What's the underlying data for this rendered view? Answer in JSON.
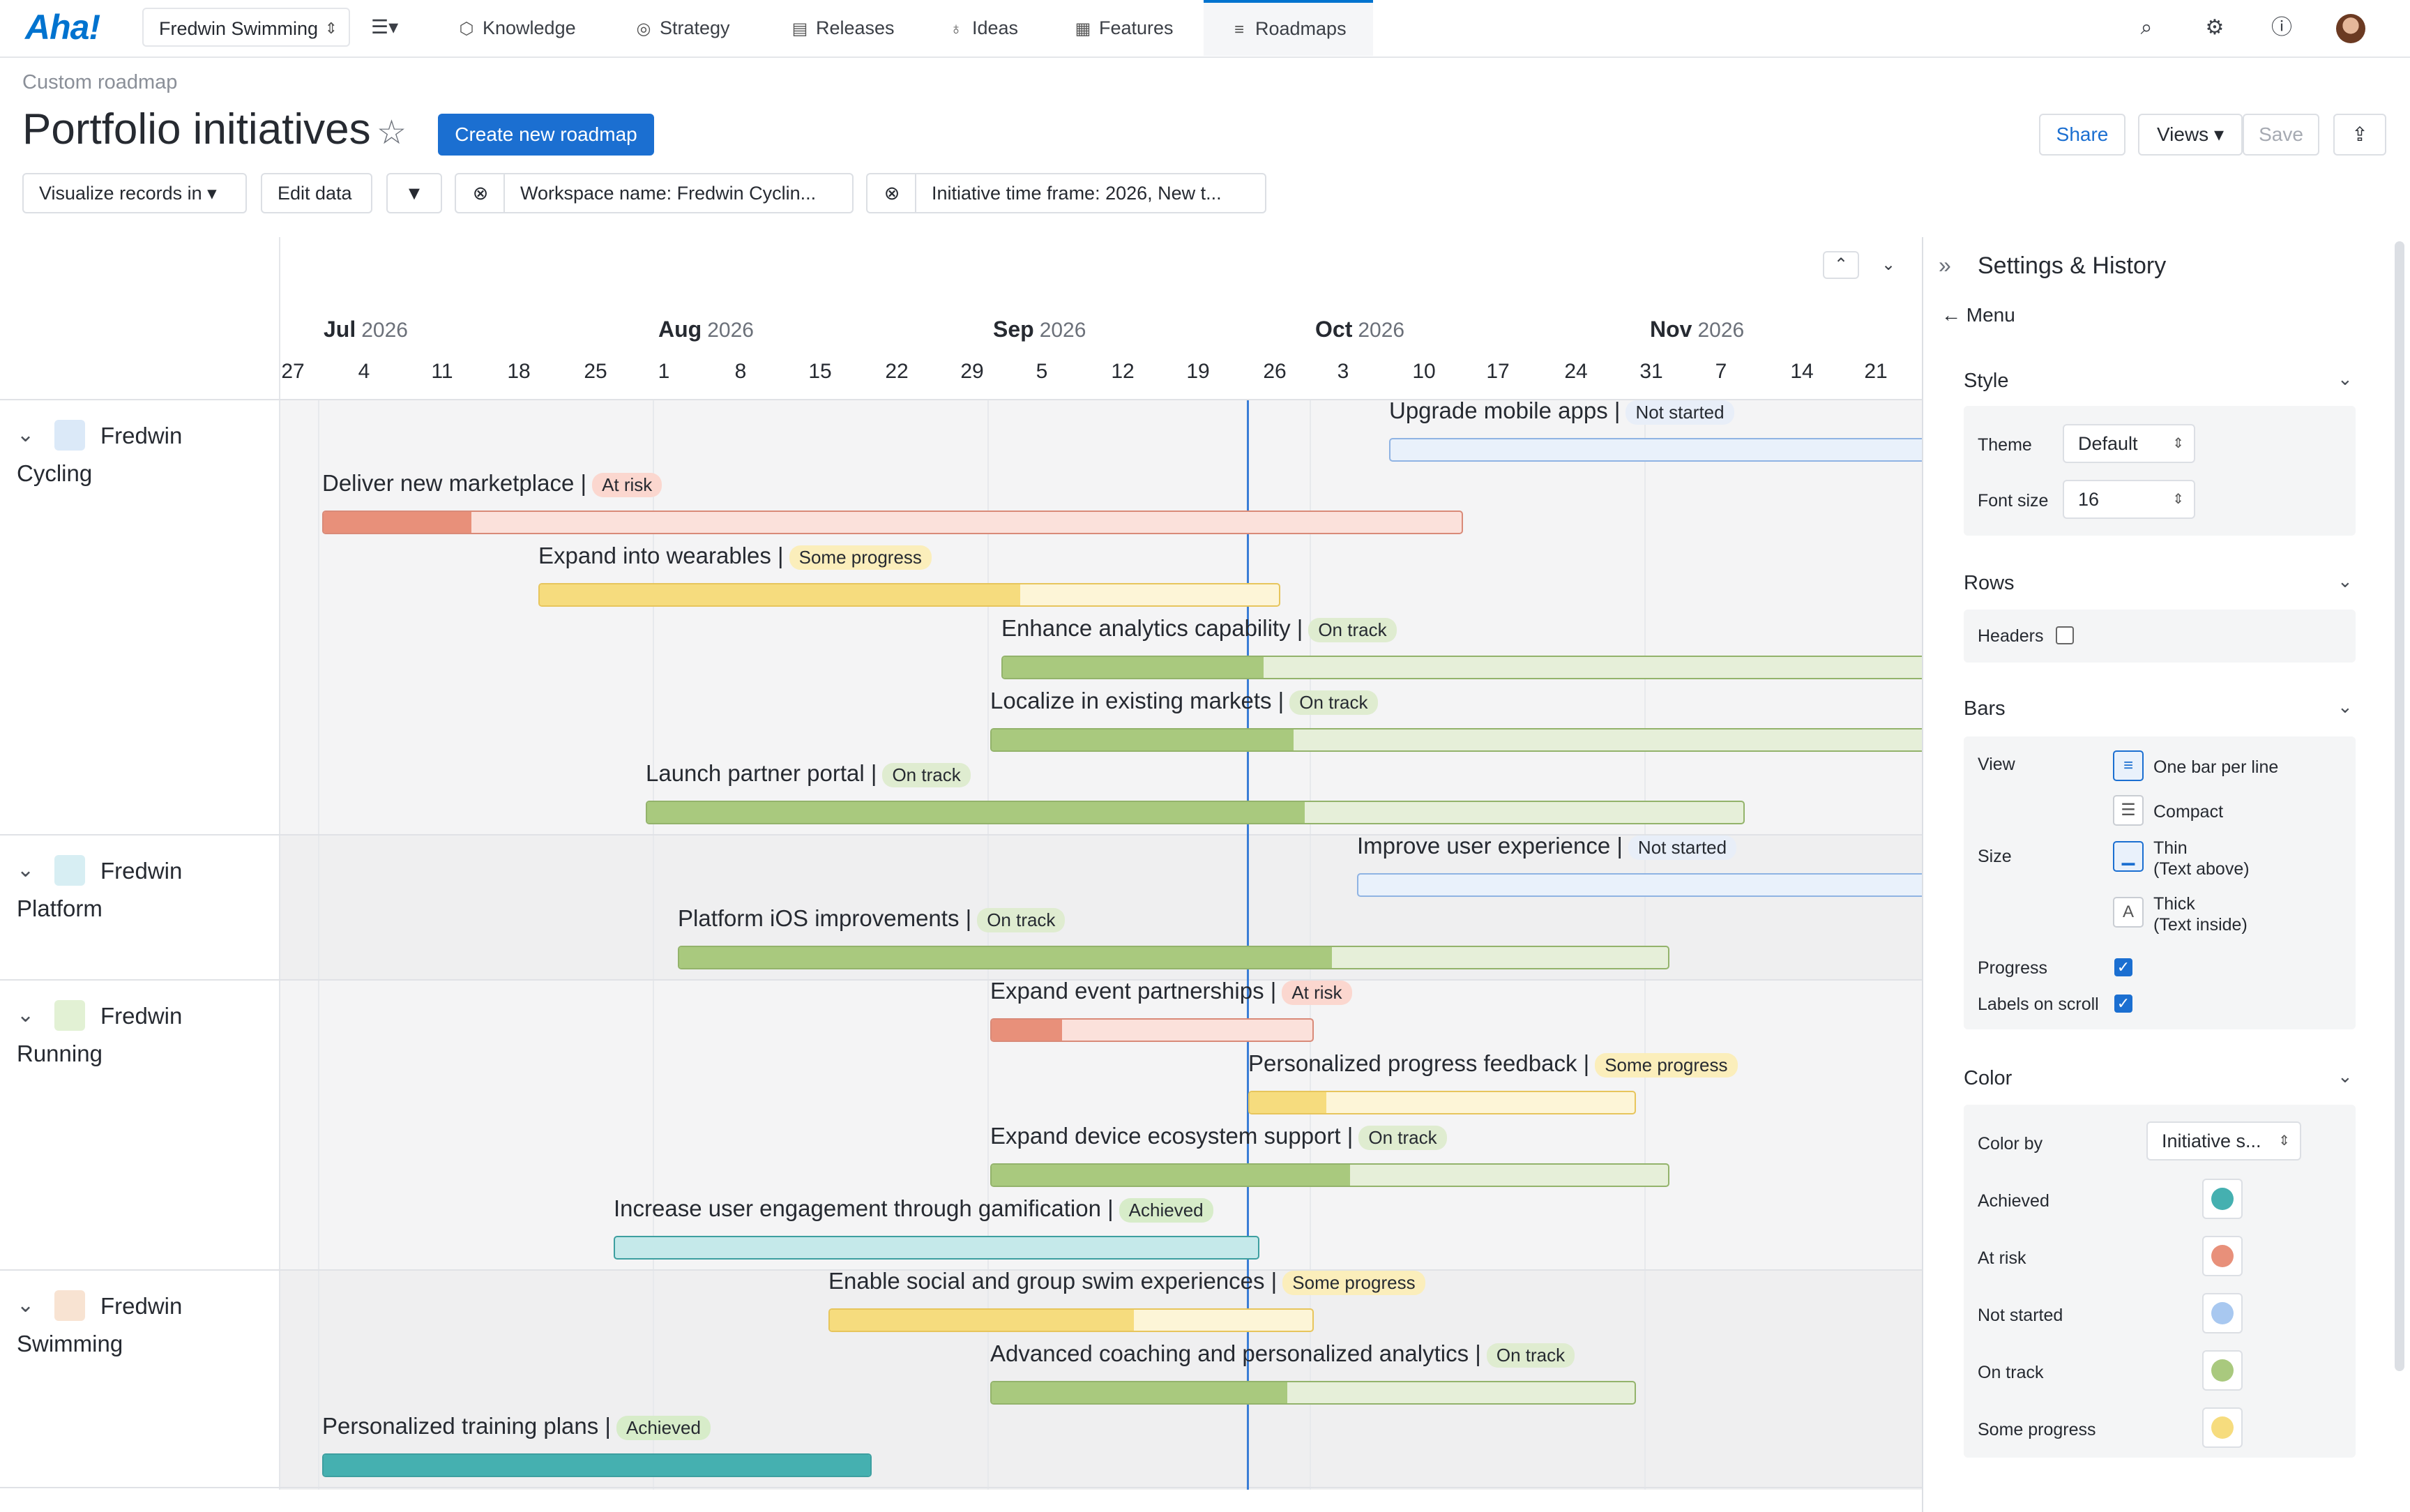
{
  "nav": {
    "logo": "Aha!",
    "workspace": "Fredwin Swimming",
    "items": [
      {
        "label": "Knowledge",
        "icon": "knowledge-icon"
      },
      {
        "label": "Strategy",
        "icon": "strategy-icon"
      },
      {
        "label": "Releases",
        "icon": "releases-icon"
      },
      {
        "label": "Ideas",
        "icon": "ideas-icon"
      },
      {
        "label": "Features",
        "icon": "features-icon"
      },
      {
        "label": "Roadmaps",
        "icon": "roadmaps-icon"
      }
    ]
  },
  "header": {
    "breadcrumb": "Custom roadmap",
    "title": "Portfolio initiatives",
    "create_label": "Create new roadmap",
    "share_label": "Share",
    "views_label": "Views ▾",
    "save_label": "Save"
  },
  "toolbar": {
    "visualize_label": "Visualize records in ▾",
    "edit_label": "Edit data",
    "filter1": "Workspace name: Fredwin Cyclin...",
    "filter2": "Initiative time frame: 2026, New t..."
  },
  "timeline": {
    "months": [
      {
        "name": "Jul",
        "year": "2026"
      },
      {
        "name": "Aug",
        "year": "2026"
      },
      {
        "name": "Sep",
        "year": "2026"
      },
      {
        "name": "Oct",
        "year": "2026"
      },
      {
        "name": "Nov",
        "year": "2026"
      }
    ],
    "weeks": [
      "27",
      "4",
      "11",
      "18",
      "25",
      "1",
      "8",
      "15",
      "22",
      "29",
      "5",
      "12",
      "19",
      "26",
      "3",
      "10",
      "17",
      "24",
      "31",
      "7",
      "14",
      "21"
    ]
  },
  "lanes": [
    {
      "line1": "Fredwin",
      "line2": "Cycling"
    },
    {
      "line1": "Fredwin",
      "line2": "Platform"
    },
    {
      "line1": "Fredwin",
      "line2": "Running"
    },
    {
      "line1": "Fredwin",
      "line2": "Swimming"
    }
  ],
  "statuses": {
    "not_started": "Not started",
    "at_risk": "At risk",
    "some_progress": "Some progress",
    "on_track": "On track",
    "achieved": "Achieved"
  },
  "colors": {
    "not_started": "#a8c8f0",
    "at_risk": "#e8907a",
    "some_progress": "#f6dc7e",
    "on_track": "#a9c97e",
    "achieved": "#45b0b0",
    "accent": "#1b6fd1"
  },
  "bars": [
    {
      "title": "Upgrade mobile apps",
      "status": "Not started",
      "progress": 0
    },
    {
      "title": "Deliver new marketplace",
      "status": "At risk",
      "progress": 0.13
    },
    {
      "title": "Expand into wearables",
      "status": "Some progress",
      "progress": 0.65
    },
    {
      "title": "Enhance analytics capability",
      "status": "On track",
      "progress": 0.28
    },
    {
      "title": "Localize in existing markets",
      "status": "On track",
      "progress": 0.32
    },
    {
      "title": "Launch partner portal",
      "status": "On track",
      "progress": 0.6
    },
    {
      "title": "Improve user experience",
      "status": "Not started",
      "progress": 0
    },
    {
      "title": "Platform iOS improvements",
      "status": "On track",
      "progress": 0.66
    },
    {
      "title": "Expand event partnerships",
      "status": "At risk",
      "progress": 0.22
    },
    {
      "title": "Personalized progress feedback",
      "status": "Some progress",
      "progress": 0.2
    },
    {
      "title": "Expand device ecosystem support",
      "status": "On track",
      "progress": 0.53
    },
    {
      "title": "Increase user engagement through gamification",
      "status": "Achieved",
      "progress": 0
    },
    {
      "title": "Enable social and group swim experiences",
      "status": "Some progress",
      "progress": 0.63
    },
    {
      "title": "Advanced coaching and personalized analytics",
      "status": "On track",
      "progress": 0.46
    },
    {
      "title": "Personalized training plans",
      "status": "Achieved",
      "progress": 1
    }
  ],
  "panel": {
    "title": "Settings & History",
    "menu": "Menu",
    "style": {
      "title": "Style",
      "theme_label": "Theme",
      "theme": "Default",
      "font_label": "Font size",
      "font": "16"
    },
    "rows": {
      "title": "Rows",
      "headers_label": "Headers"
    },
    "bars": {
      "title": "Bars",
      "view_label": "View",
      "one_bar": "One bar per line",
      "compact": "Compact",
      "size_label": "Size",
      "thin": "Thin",
      "thin_sub": "(Text above)",
      "thick": "Thick",
      "thick_sub": "(Text inside)",
      "progress_label": "Progress",
      "scroll_label": "Labels on scroll"
    },
    "color": {
      "title": "Color",
      "color_by_label": "Color by",
      "color_by": "Initiative s...",
      "items": [
        "Achieved",
        "At risk",
        "Not started",
        "On track",
        "Some progress"
      ]
    }
  }
}
